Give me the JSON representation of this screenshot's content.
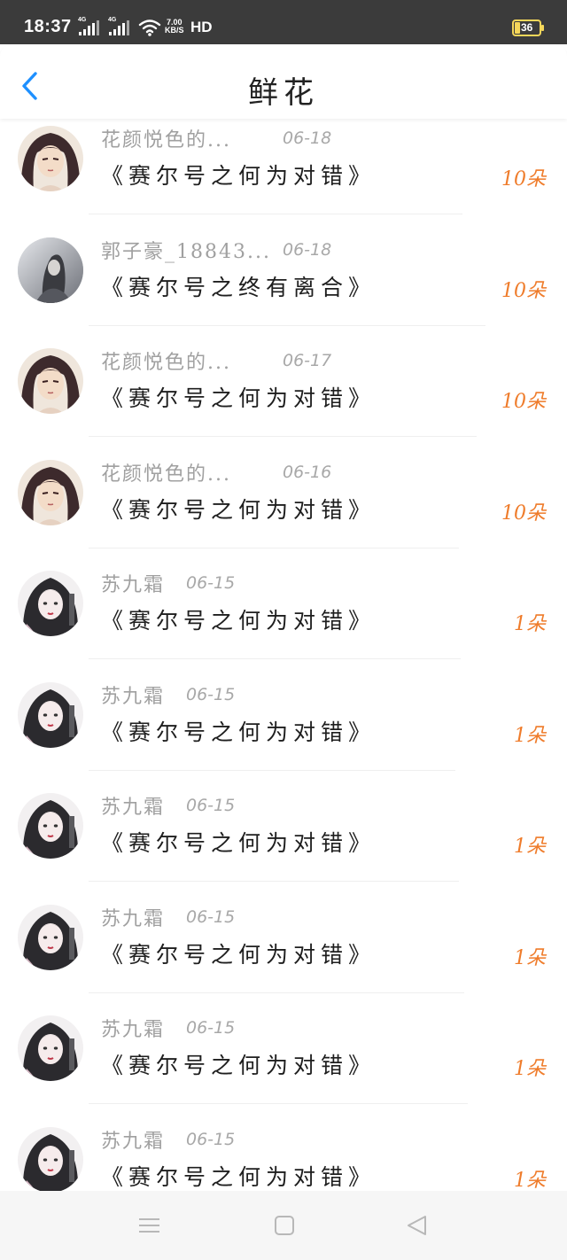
{
  "status_bar": {
    "time": "18:37",
    "signal1_label": "4G",
    "signal2_label": "4G",
    "speed_value": "7.00",
    "speed_unit": "KB/S",
    "hd_label": "HD",
    "battery_level": "36",
    "icons": [
      "signal-icon",
      "wifi-icon",
      "battery-icon"
    ]
  },
  "header": {
    "back_icon": "back-chevron-icon",
    "title": "鲜花"
  },
  "colors": {
    "accent_blue": "#1e90ff",
    "flower_count_orange": "#ef7c2b",
    "meta_gray": "#a0a0a0",
    "status_bar_bg": "#3b3b3b"
  },
  "list": {
    "items": [
      {
        "name": "花颜悦色的...",
        "date": "06-18",
        "work": "《赛尔号之何为对错》",
        "count": "10朵",
        "avatar": "avatar-dark-hair"
      },
      {
        "name": "郭子豪_18843...",
        "date": "06-18",
        "work": "《赛尔号之终有离合》",
        "count": "10朵",
        "avatar": "avatar-gray"
      },
      {
        "name": "花颜悦色的...",
        "date": "06-17",
        "work": "《赛尔号之何为对错》",
        "count": "10朵",
        "avatar": "avatar-dark-hair"
      },
      {
        "name": "花颜悦色的...",
        "date": "06-16",
        "work": "《赛尔号之何为对错》",
        "count": "10朵",
        "avatar": "avatar-dark-hair"
      },
      {
        "name": "苏九霜",
        "date": "06-15",
        "work": "《赛尔号之何为对错》",
        "count": "1朵",
        "avatar": "avatar-braided-girl"
      },
      {
        "name": "苏九霜",
        "date": "06-15",
        "work": "《赛尔号之何为对错》",
        "count": "1朵",
        "avatar": "avatar-braided-girl"
      },
      {
        "name": "苏九霜",
        "date": "06-15",
        "work": "《赛尔号之何为对错》",
        "count": "1朵",
        "avatar": "avatar-braided-girl"
      },
      {
        "name": "苏九霜",
        "date": "06-15",
        "work": "《赛尔号之何为对错》",
        "count": "1朵",
        "avatar": "avatar-braided-girl"
      },
      {
        "name": "苏九霜",
        "date": "06-15",
        "work": "《赛尔号之何为对错》",
        "count": "1朵",
        "avatar": "avatar-braided-girl"
      },
      {
        "name": "苏九霜",
        "date": "06-15",
        "work": "《赛尔号之何为对错》",
        "count": "1朵",
        "avatar": "avatar-braided-girl"
      }
    ]
  },
  "nav_bar": {
    "icons": [
      "menu-icon",
      "home-square-icon",
      "back-triangle-icon"
    ]
  }
}
